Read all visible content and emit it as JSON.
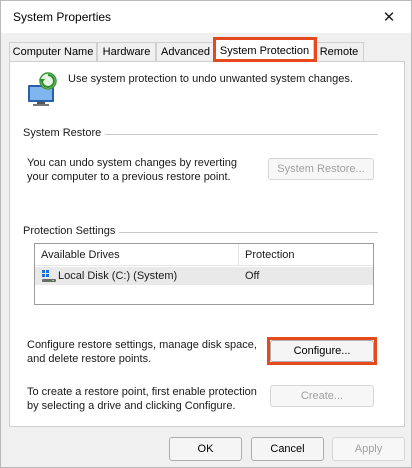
{
  "window": {
    "title": "System Properties",
    "close_glyph": "✕"
  },
  "tabs": [
    {
      "label": "Computer Name"
    },
    {
      "label": "Hardware"
    },
    {
      "label": "Advanced"
    },
    {
      "label": "System Protection",
      "active": true
    },
    {
      "label": "Remote"
    }
  ],
  "intro": {
    "text": "Use system protection to undo unwanted system changes.",
    "icon": "system-protection-icon"
  },
  "system_restore": {
    "heading": "System Restore",
    "description_line1": "You can undo system changes by reverting",
    "description_line2": "your computer to a previous restore point.",
    "button_label": "System Restore..."
  },
  "protection_settings": {
    "heading": "Protection Settings",
    "columns": [
      "Available Drives",
      "Protection"
    ],
    "drives": [
      {
        "name": "Local Disk (C:) (System)",
        "protection": "Off",
        "icon": "disk-icon"
      }
    ]
  },
  "configure": {
    "description_line1": "Configure restore settings, manage disk space,",
    "description_line2": "and delete restore points.",
    "button_label": "Configure..."
  },
  "create": {
    "description_line1": "To create a restore point, first enable protection",
    "description_line2": "by selecting a drive and clicking Configure.",
    "button_label": "Create..."
  },
  "footer": {
    "ok_label": "OK",
    "cancel_label": "Cancel",
    "apply_label": "Apply"
  },
  "colors": {
    "highlight": "#e54a1f",
    "accent_blue": "#1e6fd9"
  }
}
